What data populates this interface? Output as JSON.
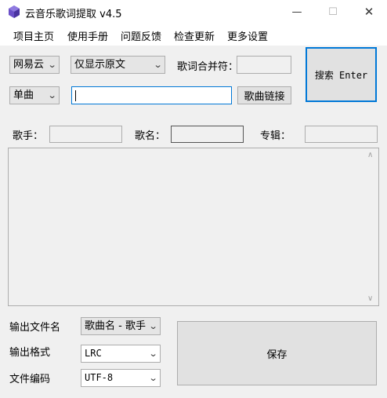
{
  "window": {
    "title": "云音乐歌词提取 v4.5",
    "min_glyph": "—",
    "max_glyph": "☐",
    "close_glyph": "✕"
  },
  "menu": [
    "项目主页",
    "使用手册",
    "问题反馈",
    "检查更新",
    "更多设置"
  ],
  "source_select": "网易云",
  "display_select": "仅显示原文",
  "merge_label": "歌词合并符：",
  "merge_value": "",
  "search_button": "搜索 Enter",
  "search_type_select": "单曲",
  "search_input": "",
  "song_link_button": "歌曲链接",
  "info": {
    "artist_label": "歌手：",
    "song_label": "歌名：",
    "album_label": "专辑："
  },
  "output": {
    "filename_label": "输出文件名",
    "filename_value": "歌曲名 - 歌手",
    "format_label": "输出格式",
    "format_value": "LRC",
    "encoding_label": "文件编码",
    "encoding_value": "UTF-8"
  },
  "save_button": "保存",
  "arrow_glyph": "⌄",
  "scroll_up": "∧",
  "scroll_down": "∨"
}
